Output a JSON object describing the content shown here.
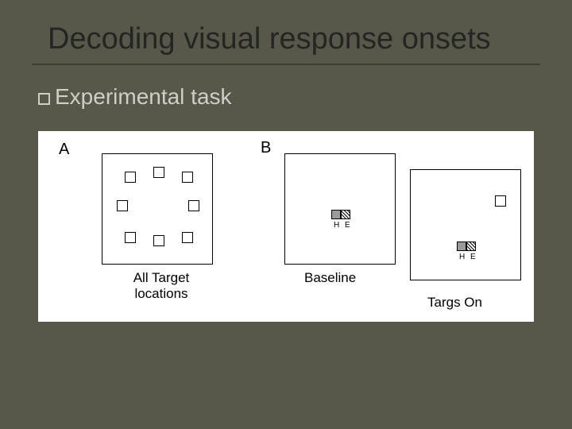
{
  "title": "Decoding visual response onsets",
  "bullet": "Experimental task",
  "figure": {
    "panelA": {
      "label": "A",
      "caption": "All Target\nlocations"
    },
    "panelB": {
      "label": "B",
      "caption_baseline": "Baseline",
      "caption_targs": "Targs On"
    },
    "fixation_label": "H E"
  }
}
